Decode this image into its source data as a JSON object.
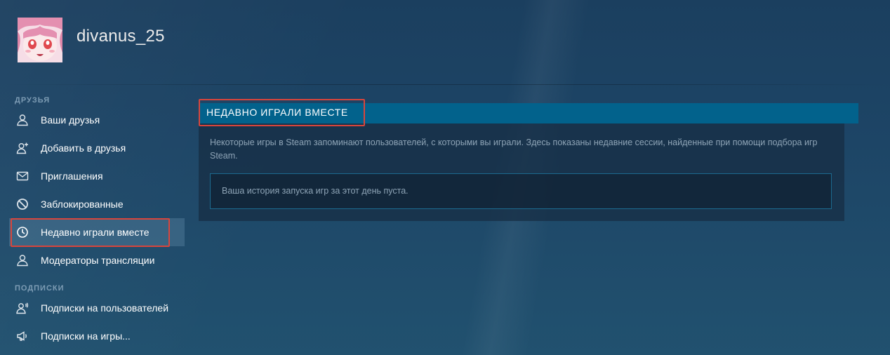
{
  "profile": {
    "username": "divanus_25",
    "avatar_icon": "anime-avatar"
  },
  "sidebar": {
    "sections": [
      {
        "label": "ДРУЗЬЯ",
        "items": [
          {
            "label": "Ваши друзья",
            "icon": "person-icon"
          },
          {
            "label": "Добавить в друзья",
            "icon": "add-person-icon"
          },
          {
            "label": "Приглашения",
            "icon": "envelope-icon"
          },
          {
            "label": "Заблокированные",
            "icon": "blocked-icon"
          },
          {
            "label": "Недавно играли вместе",
            "icon": "clock-icon",
            "active": true
          },
          {
            "label": "Модераторы трансляции",
            "icon": "person-icon"
          }
        ]
      },
      {
        "label": "ПОДПИСКИ",
        "items": [
          {
            "label": "Подписки на пользователей",
            "icon": "person-broadcast-icon"
          },
          {
            "label": "Подписки на игры...",
            "icon": "megaphone-icon"
          }
        ]
      }
    ]
  },
  "main": {
    "title": "НЕДАВНО ИГРАЛИ ВМЕСТЕ",
    "description": "Некоторые игры в Steam запоминают пользователей, с которыми вы играли. Здесь показаны недавние сессии, найденные при помощи подбора игр Steam.",
    "empty_message": "Ваша история запуска игр за этот день пуста."
  },
  "colors": {
    "background": "#1f4a6b",
    "header_bar": "#02628c",
    "highlight": "#d9453c",
    "muted_text": "#8ea4b6"
  }
}
